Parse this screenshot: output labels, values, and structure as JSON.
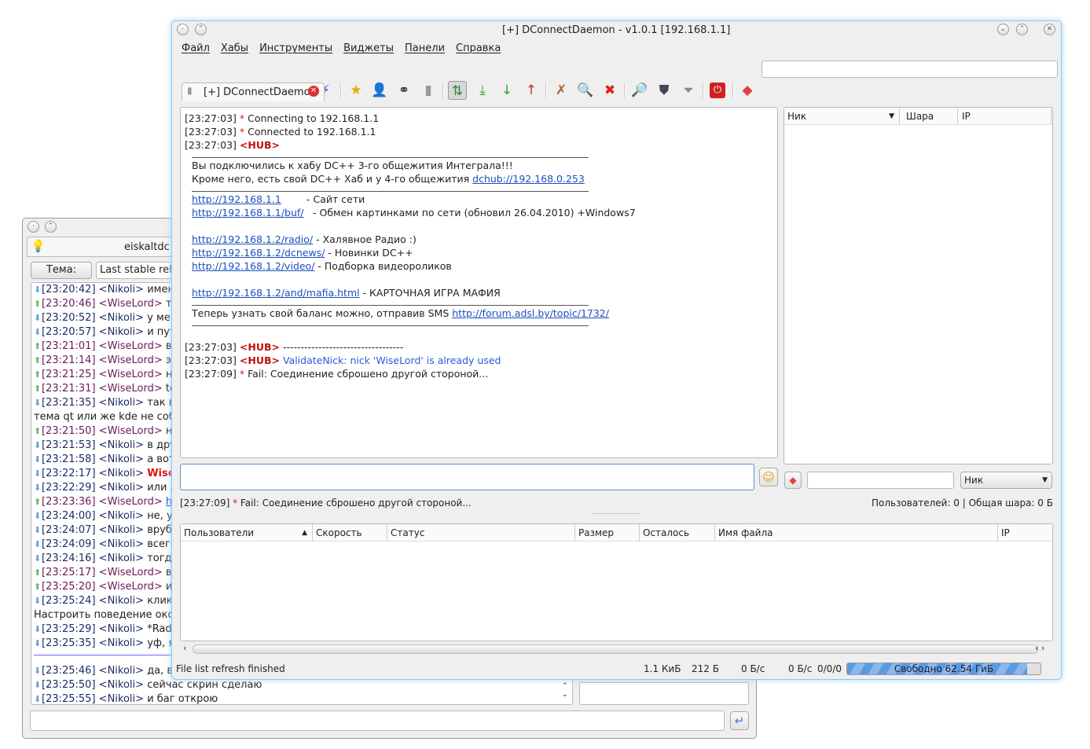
{
  "bg_window": {
    "tab_title": "eiskaltdc",
    "topic_button": "Тема:",
    "topic_value": "Last stable relea",
    "messages": [
      {
        "dir": "down",
        "time": "[23:20:42]",
        "nick": "<Nikoli>",
        "text": "именно"
      },
      {
        "dir": "up",
        "time": "[23:20:46]",
        "nick": "<WiseLord>",
        "text": "такс"
      },
      {
        "dir": "down",
        "time": "[23:20:52]",
        "nick": "<Nikoli>",
        "text": "у меня"
      },
      {
        "dir": "down",
        "time": "[23:20:57]",
        "nick": "<Nikoli>",
        "text": "и путь д"
      },
      {
        "dir": "up",
        "time": "[23:21:01]",
        "nick": "<WiseLord>",
        "text": "во-в"
      },
      {
        "dir": "up",
        "time": "[23:21:14]",
        "nick": "<WiseLord>",
        "text": "этом"
      },
      {
        "dir": "up",
        "time": "[23:21:25]",
        "nick": "<WiseLord>",
        "text": "ну и"
      },
      {
        "dir": "up",
        "time": "[23:21:31]",
        "nick": "<WiseLord>",
        "text": "tehn"
      },
      {
        "dir": "down",
        "time": "[23:21:35]",
        "nick": "<Nikoli>",
        "text": "так вот"
      },
      {
        "plain": "тема qt или же kde не соблюд"
      },
      {
        "dir": "up",
        "time": "[23:21:50]",
        "nick": "<WiseLord>",
        "text": "ну н"
      },
      {
        "dir": "down",
        "time": "[23:21:53]",
        "nick": "<Nikoli>",
        "text": "в други"
      },
      {
        "dir": "down",
        "time": "[23:21:58]",
        "nick": "<Nikoli>",
        "text": "а вот и"
      },
      {
        "dir": "down",
        "time": "[23:22:17]",
        "nick": "<Nikoli>",
        "text": "WiseLo",
        "highlight": true
      },
      {
        "dir": "down",
        "time": "[23:22:29]",
        "nick": "<Nikoli>",
        "text": "или же"
      },
      {
        "dir": "up",
        "time": "[23:23:36]",
        "nick": "<WiseLord>",
        "text": "http",
        "link": true
      },
      {
        "dir": "down",
        "time": "[23:24:00]",
        "nick": "<Nikoli>",
        "text": "не, у те"
      },
      {
        "dir": "down",
        "time": "[23:24:07]",
        "nick": "<Nikoli>",
        "text": "вруби т"
      },
      {
        "dir": "down",
        "time": "[23:24:09]",
        "nick": "<Nikoli>",
        "text": "всего"
      },
      {
        "dir": "down",
        "time": "[23:24:16]",
        "nick": "<Nikoli>",
        "text": "тогда у"
      },
      {
        "dir": "up",
        "time": "[23:25:17]",
        "nick": "<WiseLord>",
        "text": "в си"
      },
      {
        "dir": "up",
        "time": "[23:25:20]",
        "nick": "<WiseLord>",
        "text": "или"
      },
      {
        "dir": "down",
        "time": "[23:25:24]",
        "nick": "<Nikoli>",
        "text": "кликни"
      },
      {
        "plain": "Настроить поведение окон/ С"
      },
      {
        "dir": "down",
        "time": "[23:25:29]",
        "nick": "<Nikoli>",
        "text": "*Radial"
      },
      {
        "dir": "down",
        "time": "[23:25:35]",
        "nick": "<Nikoli>",
        "text": "уф, я эт"
      },
      {
        "separator": true
      },
      {
        "dir": "down",
        "time": "[23:25:46]",
        "nick": "<Nikoli>",
        "text": "да, в те"
      },
      {
        "dir": "down",
        "time": "[23:25:50]",
        "nick": "<Nikoli>",
        "text": "сейчас скрин сделаю"
      },
      {
        "dir": "down",
        "time": "[23:25:55]",
        "nick": "<Nikoli>",
        "text": "и баг открою"
      }
    ]
  },
  "window": {
    "title": "[+] DConnectDaemon - v1.0.1 [192.168.1.1]"
  },
  "menu": [
    "Файл",
    "Хабы",
    "Инструменты",
    "Виджеты",
    "Панели",
    "Справка"
  ],
  "toolbar": {
    "search_placeholder": ""
  },
  "tab": {
    "label": "[+] DConnectDaemon"
  },
  "chat": {
    "lines": [
      {
        "t": "[23:27:03]",
        "star": "*",
        "text": " Connecting to 192.168.1.1"
      },
      {
        "t": "[23:27:03]",
        "star": "*",
        "text": " Connected to 192.168.1.1"
      },
      {
        "t": "[23:27:03]",
        "hub": "<HUB>"
      }
    ],
    "motd": {
      "welcome": "Вы подключились к хабу DC++ 3-го общежития Интеграла!!!",
      "other_hub_text": "Кроме него, есть свой DC++ Хаб и у 4-го общежития ",
      "other_hub_link": "dchub://192.168.0.253",
      "links1": [
        {
          "url": "http://192.168.1.1",
          "desc": "- Сайт сети"
        },
        {
          "url": "http://192.168.1.1/buf/",
          "desc": "- Обмен картинками по сети (обновил 26.04.2010) +Windows7"
        }
      ],
      "links2": [
        {
          "url": "http://192.168.1.2/radio/",
          "desc": " - Халявное Радио :)"
        },
        {
          "url": "http://192.168.1.2/dcnews/",
          "desc": " - Новинки DC++"
        },
        {
          "url": "http://192.168.1.2/video/",
          "desc": " - Подборка видеороликов"
        }
      ],
      "mafia": {
        "url": "http://192.168.1.2/and/mafia.html",
        "desc": " - КАРТОЧНАЯ ИГРА МАФИЯ"
      },
      "sms_text": "Теперь узнать свой баланс можно, отправив SMS ",
      "sms_link": "http://forum.adsl.by/topic/1732/"
    },
    "tail": [
      {
        "t": "[23:27:03]",
        "hub": "<HUB>",
        "text": " ----------------------------------",
        "blue": false
      },
      {
        "t": "[23:27:03]",
        "hub": "<HUB>",
        "text": " ValidateNick: nick 'WiseLord' is already used",
        "blue": true
      },
      {
        "t": "[23:27:09]",
        "star": "*",
        "text": " Fail: Соединение сброшено другой стороной..."
      }
    ]
  },
  "userlist": {
    "columns": [
      "Ник",
      "Шара",
      "IP"
    ],
    "filter_value": "",
    "filter_combo": "Ник"
  },
  "status_line": {
    "time": "[23:27:09]",
    "star": "*",
    "text": " Fail: Соединение сброшено другой стороной...",
    "users": "Пользователей: 0 | Общая шара: 0 Б"
  },
  "transfers": {
    "columns": [
      "Пользователи",
      "Скорость",
      "Статус",
      "Размер",
      "Осталось",
      "Имя файла",
      "IP"
    ]
  },
  "statusbar": {
    "message": "File list refresh finished",
    "share": "1.1 КиБ",
    "up_total": "212 Б",
    "down_speed": "0 Б/с",
    "up_speed": "0 Б/с",
    "slots": "0/0/0",
    "free_space": "Свободно 62.54 ГиБ",
    "free_fraction": 0.93
  },
  "colors": {
    "accent": "#3a7fd0",
    "hub": "#c01010",
    "link": "#1a4fc0"
  }
}
